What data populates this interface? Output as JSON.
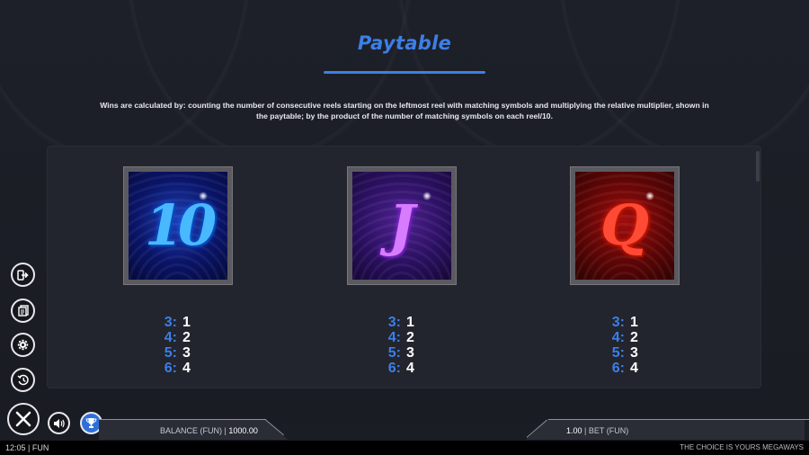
{
  "page": {
    "title": "Paytable",
    "description": "Wins are calculated by: counting the number of consecutive reels starting on the leftmost reel with matching symbols and multiplying the relative multiplier, shown in the paytable; by the product of the number of matching symbols on each reel/10."
  },
  "symbols": [
    {
      "glyph": "10",
      "color": "#49b9ff",
      "payouts": [
        {
          "count": "3:",
          "mult": "1"
        },
        {
          "count": "4:",
          "mult": "2"
        },
        {
          "count": "5:",
          "mult": "3"
        },
        {
          "count": "6:",
          "mult": "4"
        }
      ]
    },
    {
      "glyph": "J",
      "color": "#d77cff",
      "payouts": [
        {
          "count": "3:",
          "mult": "1"
        },
        {
          "count": "4:",
          "mult": "2"
        },
        {
          "count": "5:",
          "mult": "3"
        },
        {
          "count": "6:",
          "mult": "4"
        }
      ]
    },
    {
      "glyph": "Q",
      "color": "#ff4a36",
      "payouts": [
        {
          "count": "3:",
          "mult": "1"
        },
        {
          "count": "4:",
          "mult": "2"
        },
        {
          "count": "5:",
          "mult": "3"
        },
        {
          "count": "6:",
          "mult": "4"
        }
      ]
    }
  ],
  "controls": {
    "side": [
      {
        "icon": "exit-icon"
      },
      {
        "icon": "paytable-icon"
      },
      {
        "icon": "settings-icon"
      },
      {
        "icon": "history-icon"
      }
    ],
    "close_icon": "close-icon",
    "sound_icon": "speaker-icon",
    "trophy_icon": "trophy-icon"
  },
  "footer": {
    "balance_label": "BALANCE (FUN) | ",
    "balance_value": "1000.00",
    "bet_value": "1.00",
    "bet_label": " | BET  (FUN)",
    "clock": "12:05 | FUN",
    "game_name": "THE CHOICE IS YOURS MEGAWAYS"
  },
  "colors": {
    "accent": "#3d7fe6",
    "background": "#1b1d24"
  }
}
